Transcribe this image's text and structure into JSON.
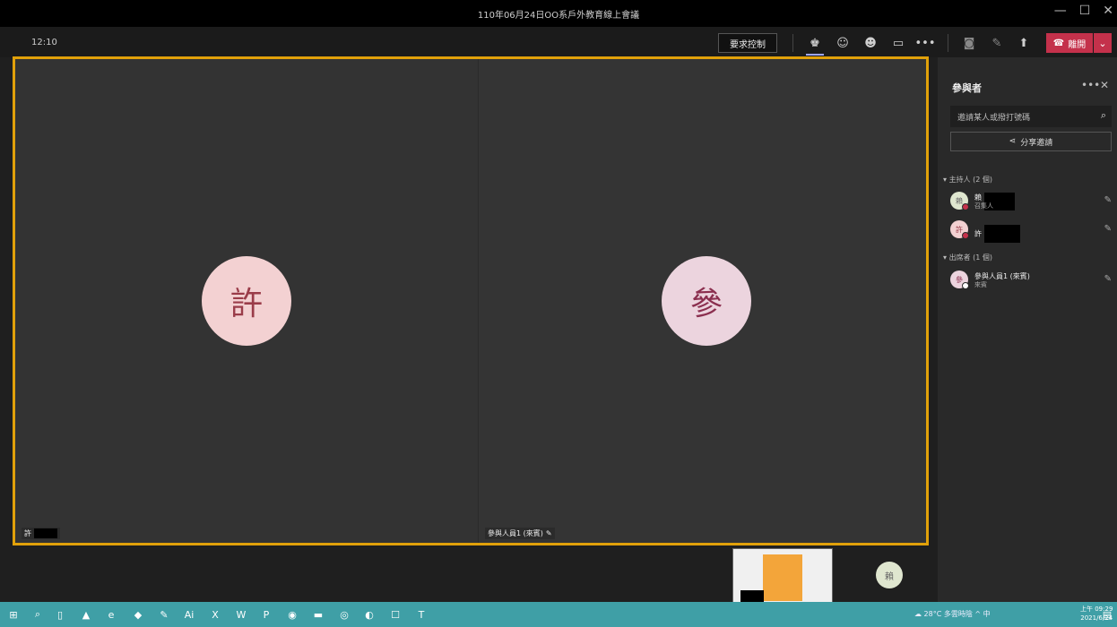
{
  "window": {
    "title": "110年06月24日OO系戶外教育線上會議",
    "minimize": "—",
    "maximize": "☐",
    "close": "✕"
  },
  "meeting_bar": {
    "elapsed": "12:10",
    "request_control": "要求控制",
    "leave_label": "離開",
    "leave_caret": "⌄"
  },
  "icons": {
    "participants": "♚",
    "chat": "☺",
    "reactions": "☻",
    "rooms": "▭",
    "more": "•••",
    "camera_off": "◙",
    "mic_off": "✎",
    "share": "⬆"
  },
  "stage": {
    "left_tile": {
      "avatar_text": "許",
      "name": "許",
      "avatar_bg": "#f3d1d2",
      "avatar_fg": "#9a3c49"
    },
    "right_tile": {
      "avatar_text": "參",
      "name": "參與人員1 (來賓)",
      "avatar_bg": "#ecd4de",
      "avatar_fg": "#8b2f4f"
    }
  },
  "bottom": {
    "mini_avatar_text": "賴"
  },
  "panel": {
    "title": "參與者",
    "more": "•••",
    "close": "✕",
    "search_placeholder": "邀請某人或撥打號碼",
    "share_invite": "分享邀請",
    "presenters_label": "主持人 (2 個)",
    "attendees_label": "出席者 (1 個)",
    "presenters": [
      {
        "avatar": "賴",
        "name": "賴",
        "role": "召集人",
        "avatar_bg": "#dfe6cf",
        "avatar_fg": "#666",
        "dot": "#c4314b"
      },
      {
        "avatar": "許",
        "name": "許",
        "role": "",
        "avatar_bg": "#f3d1d2",
        "avatar_fg": "#9a3c49",
        "dot": "#c4314b"
      }
    ],
    "attendees": [
      {
        "avatar": "參",
        "name": "參與人員1 (來賓)",
        "role": "來賓",
        "avatar_bg": "#ecd4de",
        "avatar_fg": "#8b2f4f",
        "dot": "#ffffff"
      }
    ]
  },
  "taskbar": {
    "weather": "28°C 多雲時陰",
    "ime": "中",
    "time": "上午 09:29",
    "date": "2021/6/24"
  },
  "colors": {
    "stage_border": "#e1a10a",
    "leave": "#c4314b",
    "taskbar": "#3f9fa6"
  }
}
